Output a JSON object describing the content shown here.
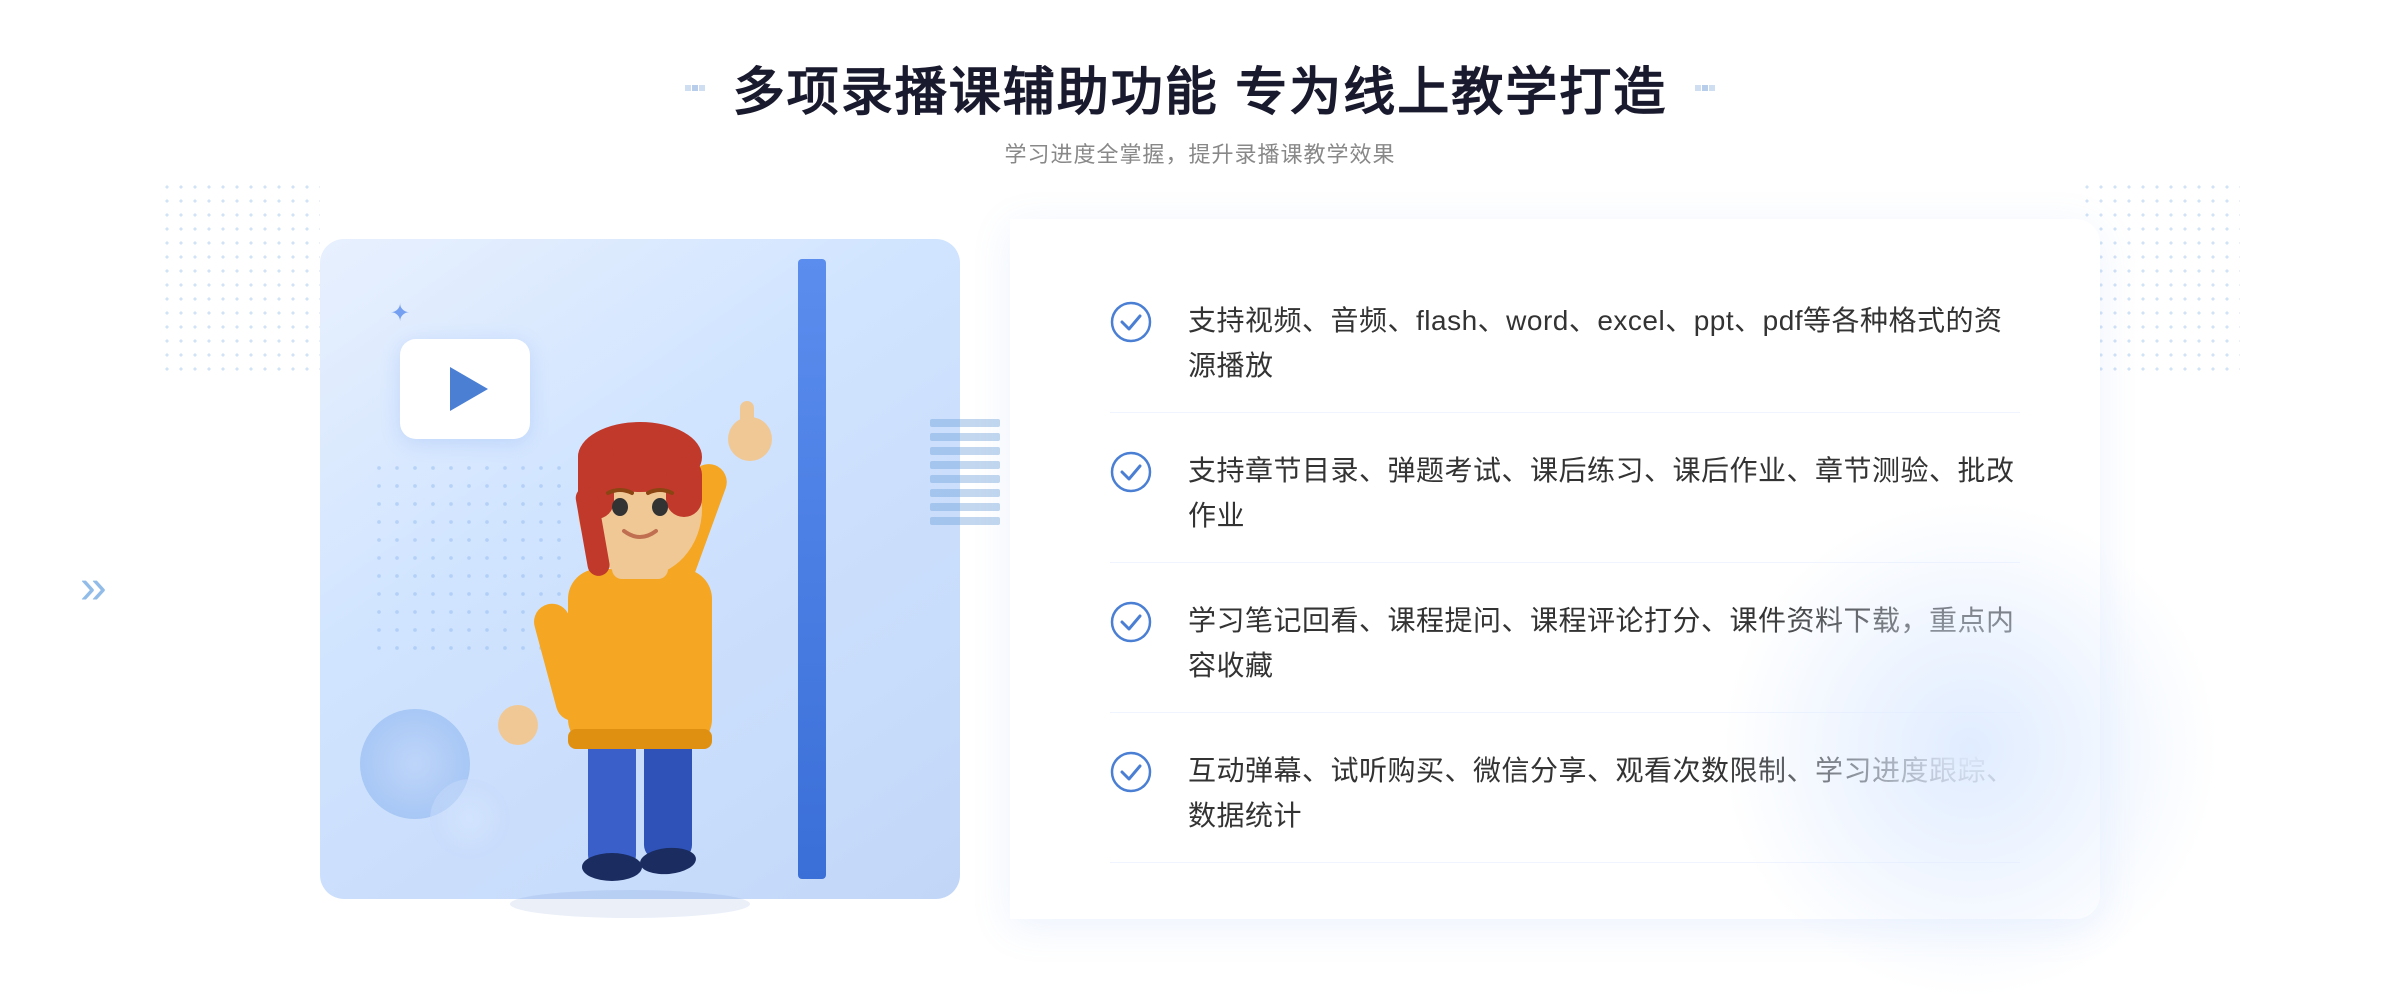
{
  "header": {
    "title": "多项录播课辅助功能 专为线上教学打造",
    "subtitle": "学习进度全掌握，提升录播课教学效果",
    "deco_label": "section-deco"
  },
  "features": [
    {
      "id": 1,
      "text": "支持视频、音频、flash、word、excel、ppt、pdf等各种格式的资源播放"
    },
    {
      "id": 2,
      "text": "支持章节目录、弹题考试、课后练习、课后作业、章节测验、批改作业"
    },
    {
      "id": 3,
      "text": "学习笔记回看、课程提问、课程评论打分、课件资料下载，重点内容收藏"
    },
    {
      "id": 4,
      "text": "互动弹幕、试听购买、微信分享、观看次数限制、学习进度跟踪、数据统计"
    }
  ],
  "illustration": {
    "play_label": "播放",
    "alt": "录播课功能示意图"
  },
  "colors": {
    "primary": "#3a6fd8",
    "secondary": "#5b8dee",
    "light_bg": "#e8f0fe",
    "text_dark": "#1a1a2e",
    "text_gray": "#888888",
    "check_color": "#4a7fd4"
  }
}
